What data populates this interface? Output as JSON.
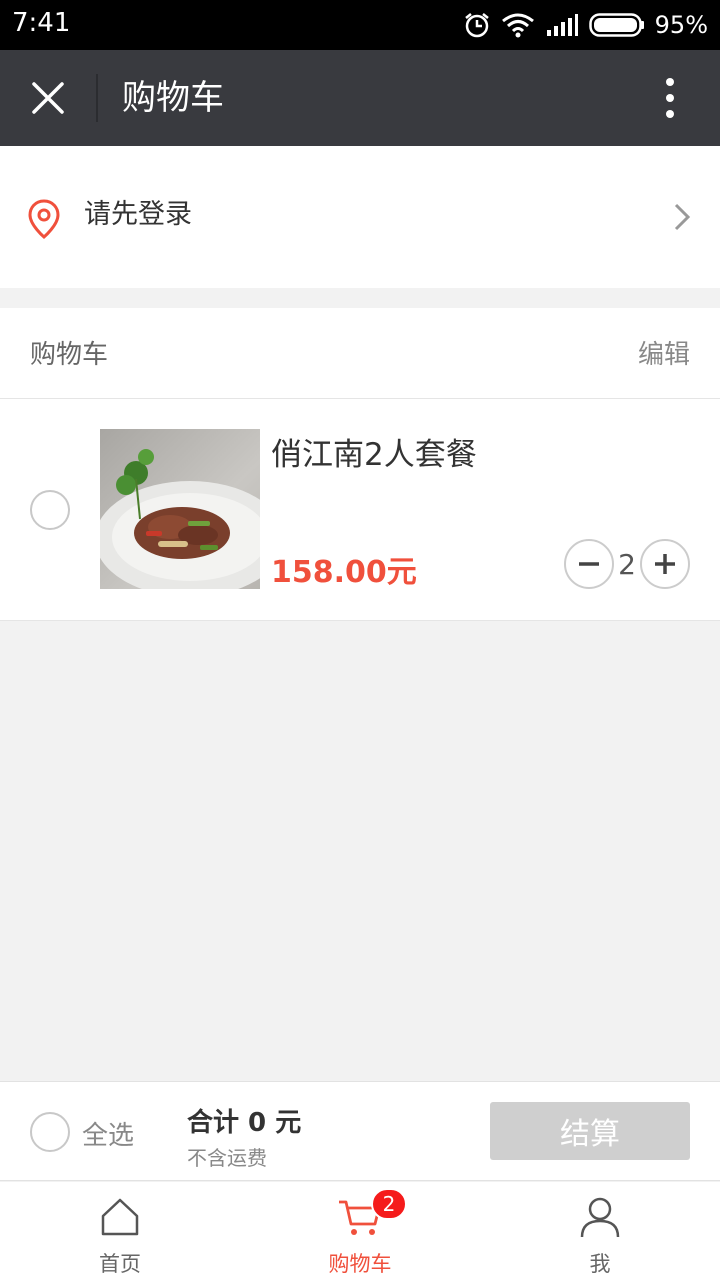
{
  "status_bar": {
    "time": "7:41",
    "battery": "95%"
  },
  "title_bar": {
    "title": "购物车"
  },
  "login": {
    "text": "请先登录"
  },
  "cart": {
    "header_title": "购物车",
    "edit_label": "编辑",
    "items": [
      {
        "name": "俏江南2人套餐",
        "price": "158.00元",
        "quantity": "2"
      }
    ]
  },
  "checkout": {
    "select_all": "全选",
    "total": "合计 0 元",
    "shipping_note": "不含运费",
    "button": "结算"
  },
  "tabs": [
    {
      "label": "首页",
      "icon": "home-icon"
    },
    {
      "label": "购物车",
      "icon": "cart-icon",
      "badge": "2",
      "active": true
    },
    {
      "label": "我",
      "icon": "user-icon"
    }
  ],
  "colors": {
    "accent": "#f0503c",
    "title_bar": "#393a3f",
    "badge": "#f51b1b"
  }
}
